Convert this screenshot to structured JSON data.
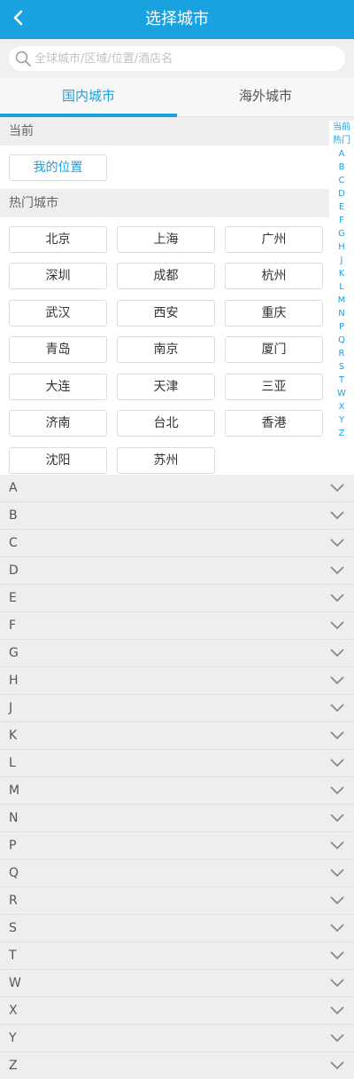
{
  "header": {
    "title": "选择城市",
    "back_icon": "chevron-left-icon"
  },
  "search": {
    "placeholder": "全球城市/区域/位置/酒店名",
    "icon": "search-icon"
  },
  "tabs": [
    {
      "label": "国内城市",
      "active": true
    },
    {
      "label": "海外城市",
      "active": false
    }
  ],
  "current": {
    "header": "当前",
    "my_location": "我的位置"
  },
  "hot": {
    "header": "热门城市",
    "cities": [
      "北京",
      "上海",
      "广州",
      "深圳",
      "成都",
      "杭州",
      "武汉",
      "西安",
      "重庆",
      "青岛",
      "南京",
      "厦门",
      "大连",
      "天津",
      "三亚",
      "济南",
      "台北",
      "香港",
      "沈阳",
      "苏州"
    ]
  },
  "letter_groups": [
    "A",
    "B",
    "C",
    "D",
    "E",
    "F",
    "G",
    "H",
    "J",
    "K",
    "L",
    "M",
    "N",
    "P",
    "Q",
    "R",
    "S",
    "T",
    "W",
    "X",
    "Y",
    "Z"
  ],
  "side_index": [
    "当前",
    "热门",
    "A",
    "B",
    "C",
    "D",
    "E",
    "F",
    "G",
    "H",
    "J",
    "K",
    "L",
    "M",
    "N",
    "P",
    "Q",
    "R",
    "S",
    "T",
    "W",
    "X",
    "Y",
    "Z"
  ],
  "colors": {
    "accent": "#1aa1e0",
    "section_bg": "#eeeeee"
  }
}
